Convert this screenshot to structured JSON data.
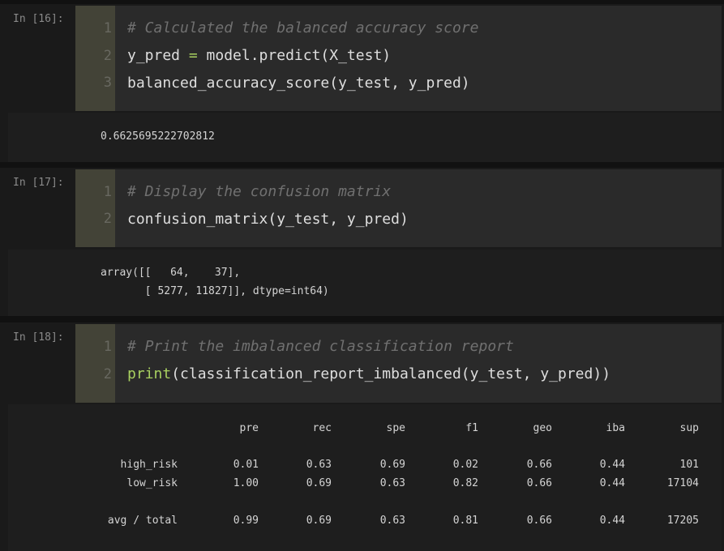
{
  "cells": [
    {
      "prompt": "In [16]:",
      "line_numbers": [
        "1",
        "2",
        "3"
      ],
      "code": {
        "comment": "# Calculated the balanced accuracy score",
        "l2_var": "y_pred ",
        "l2_op": "=",
        "l2_rest": " model.predict(X_test)",
        "l3": "balanced_accuracy_score(y_test, y_pred)"
      },
      "output": [
        "0.6625695222702812"
      ]
    },
    {
      "prompt": "In [17]:",
      "line_numbers": [
        "1",
        "2"
      ],
      "code": {
        "comment": "# Display the confusion matrix",
        "l2": "confusion_matrix(y_test, y_pred)"
      },
      "output": [
        "array([[   64,    37],",
        "       [ 5277, 11827]], dtype=int64)"
      ]
    },
    {
      "prompt": "In [18]:",
      "line_numbers": [
        "1",
        "2"
      ],
      "code": {
        "comment": "# Print the imbalanced classification report",
        "l2_kw": "print",
        "l2_rest": "(classification_report_imbalanced(y_test, y_pred))"
      },
      "report": {
        "headers": [
          "pre",
          "rec",
          "spe",
          "f1",
          "geo",
          "iba",
          "sup"
        ],
        "rows": [
          {
            "label": "high_risk",
            "values": [
              "0.01",
              "0.63",
              "0.69",
              "0.02",
              "0.66",
              "0.44",
              "101"
            ]
          },
          {
            "label": "low_risk",
            "values": [
              "1.00",
              "0.69",
              "0.63",
              "0.82",
              "0.66",
              "0.44",
              "17104"
            ]
          },
          {
            "label": "avg / total",
            "values": [
              "0.99",
              "0.69",
              "0.63",
              "0.81",
              "0.66",
              "0.44",
              "17205"
            ]
          }
        ]
      }
    }
  ]
}
